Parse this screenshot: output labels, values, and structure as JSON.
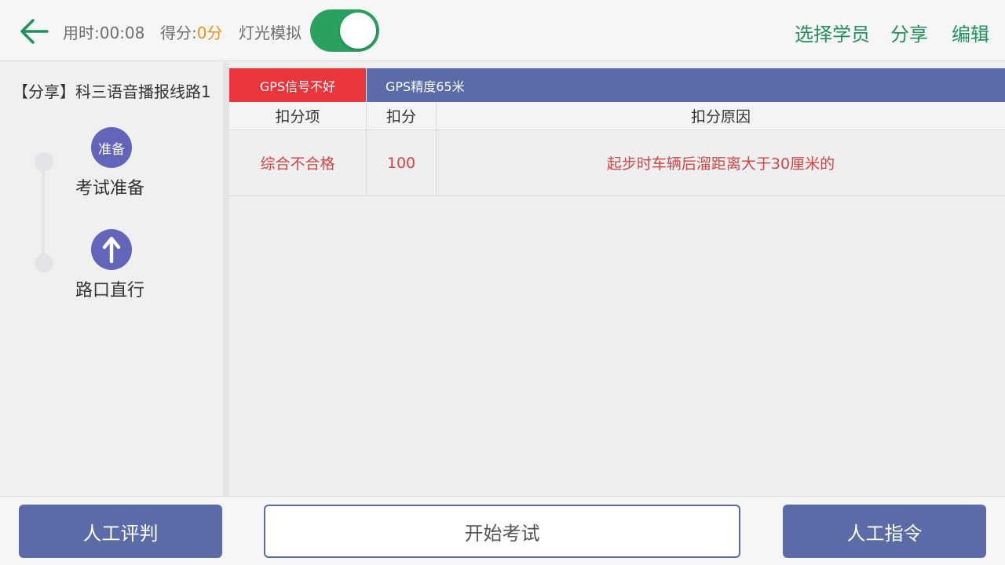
{
  "header": {
    "back_icon": "arrow-left-icon",
    "elapsed": "用时:00:08",
    "score_label": "得分:",
    "score_value": "0分",
    "light_sim_label": "灯光模拟",
    "light_sim_on": true,
    "links": {
      "select_student": "选择学员",
      "share": "分享",
      "edit": "编辑"
    }
  },
  "sidebar": {
    "route_title": "【分享】科三语音播报线路1",
    "steps": [
      {
        "circle_text": "准备",
        "label": "考试准备"
      },
      {
        "icon": "arrow-up-icon",
        "label": "路口直行"
      }
    ]
  },
  "status": {
    "gps_signal": "GPS信号不好",
    "gps_accuracy": "GPS精度65米"
  },
  "table": {
    "headers": [
      "扣分项",
      "扣分",
      "扣分原因"
    ],
    "rows": [
      [
        "综合不合格",
        "100",
        "起步时车辆后溜距离大于30厘米的"
      ]
    ]
  },
  "footer": {
    "manual_judge": "人工评判",
    "start_exam": "开始考试",
    "manual_command": "人工指令"
  },
  "colors": {
    "accent_green": "#22905a",
    "toggle_green": "#2aa15f",
    "score_orange": "#e8921f",
    "primary_blue": "#5a6ba8",
    "step_purple": "#6365b9",
    "alert_red": "#e8363c",
    "deduction_red": "#d14545"
  }
}
